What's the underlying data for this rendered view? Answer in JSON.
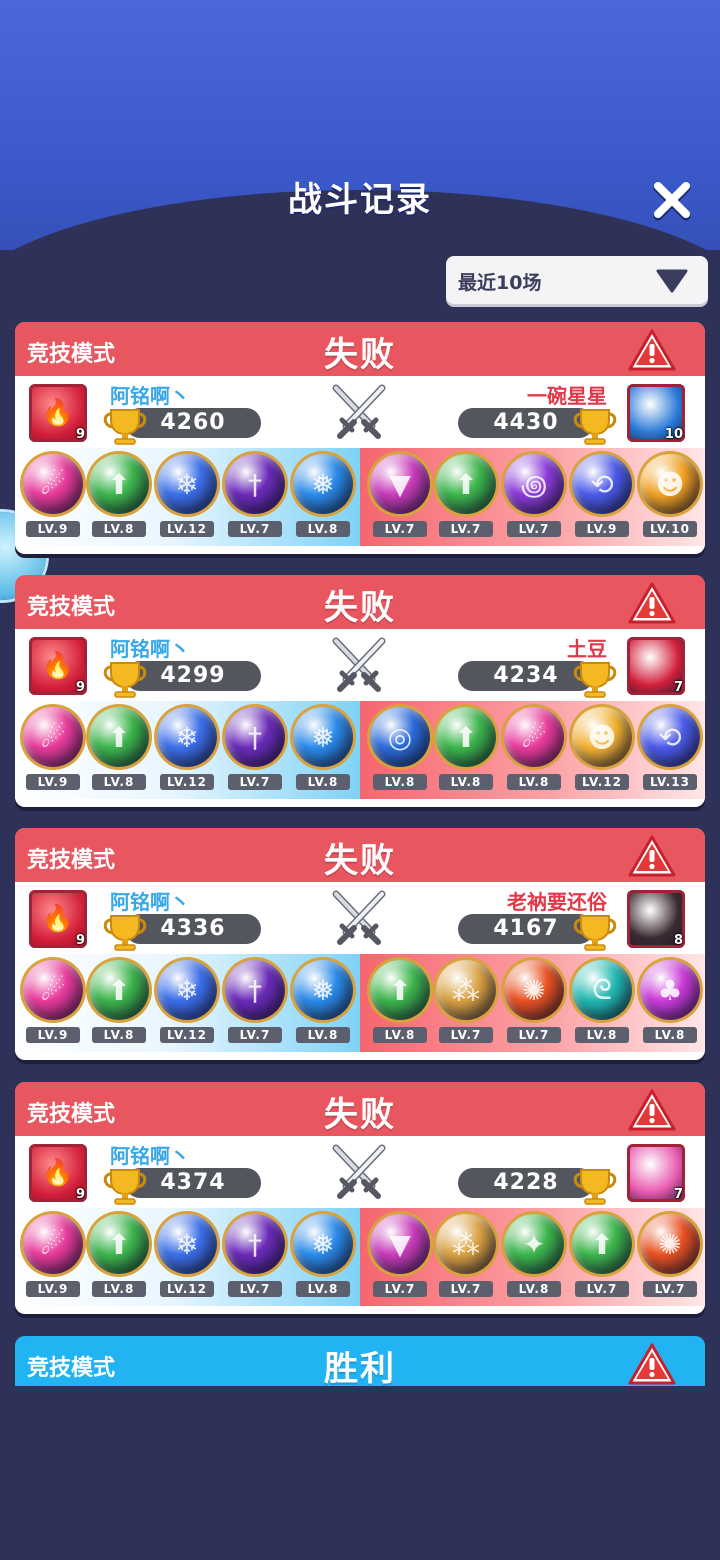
{
  "header": {
    "title": "战斗记录",
    "close_icon": "close-icon"
  },
  "filter": {
    "selected": "最近10场",
    "arrow_icon": "triangle-down-icon"
  },
  "colors": {
    "loss": "#e85660",
    "win": "#22b4f2",
    "bg": "#2e3158"
  },
  "battles": [
    {
      "mode": "竞技模式",
      "result": "失败",
      "me": {
        "name": "阿铭啊丶",
        "score": "4260",
        "avatar_level": "9",
        "avatar_color": "#d21f3a"
      },
      "opponent": {
        "name": "一碗星星",
        "score": "4430",
        "avatar_level": "10",
        "avatar_color": "#2a7ad8"
      },
      "my_skills": [
        {
          "icon": "meteor-icon",
          "level": "LV.9",
          "color": "#e83a9a"
        },
        {
          "icon": "arrow-up-icon",
          "level": "LV.8",
          "color": "#3bb44a"
        },
        {
          "icon": "snowflake-icon",
          "level": "LV.12",
          "color": "#3a6ee8"
        },
        {
          "icon": "sword-icon",
          "level": "LV.7",
          "color": "#6a2ab8"
        },
        {
          "icon": "ice-icon",
          "level": "LV.8",
          "color": "#2a8ae8"
        }
      ],
      "opp_skills": [
        {
          "icon": "prism-icon",
          "level": "LV.7",
          "color": "#c83ab8"
        },
        {
          "icon": "arrow-up-icon",
          "level": "LV.7",
          "color": "#3bb44a"
        },
        {
          "icon": "swirl-icon",
          "level": "LV.7",
          "color": "#8a3ad8"
        },
        {
          "icon": "return-icon",
          "level": "LV.9",
          "color": "#4a5ae8"
        },
        {
          "icon": "pumpkin-icon",
          "level": "LV.10",
          "color": "#f0a020"
        }
      ]
    },
    {
      "mode": "竞技模式",
      "result": "失败",
      "me": {
        "name": "阿铭啊丶",
        "score": "4299",
        "avatar_level": "9",
        "avatar_color": "#d21f3a"
      },
      "opponent": {
        "name": "土豆",
        "score": "4234",
        "avatar_level": "7",
        "avatar_color": "#d21f3a"
      },
      "my_skills": [
        {
          "icon": "meteor-icon",
          "level": "LV.9",
          "color": "#e83a9a"
        },
        {
          "icon": "arrow-up-icon",
          "level": "LV.8",
          "color": "#3bb44a"
        },
        {
          "icon": "snowflake-icon",
          "level": "LV.12",
          "color": "#3a6ee8"
        },
        {
          "icon": "sword-icon",
          "level": "LV.7",
          "color": "#6a2ab8"
        },
        {
          "icon": "ice-icon",
          "level": "LV.8",
          "color": "#2a8ae8"
        }
      ],
      "opp_skills": [
        {
          "icon": "vortex-icon",
          "level": "LV.8",
          "color": "#2a6ad8"
        },
        {
          "icon": "arrow-up-icon",
          "level": "LV.8",
          "color": "#3bb44a"
        },
        {
          "icon": "meteor-icon",
          "level": "LV.8",
          "color": "#e83a9a"
        },
        {
          "icon": "pumpkin-icon",
          "level": "LV.12",
          "color": "#f0b030"
        },
        {
          "icon": "return-icon",
          "level": "LV.13",
          "color": "#4a5ae8"
        }
      ]
    },
    {
      "mode": "竞技模式",
      "result": "失败",
      "me": {
        "name": "阿铭啊丶",
        "score": "4336",
        "avatar_level": "9",
        "avatar_color": "#d21f3a"
      },
      "opponent": {
        "name": "老衲要还俗",
        "score": "4167",
        "avatar_level": "8",
        "avatar_color": "#3a2a30"
      },
      "my_skills": [
        {
          "icon": "meteor-icon",
          "level": "LV.9",
          "color": "#e83a9a"
        },
        {
          "icon": "arrow-up-icon",
          "level": "LV.8",
          "color": "#3bb44a"
        },
        {
          "icon": "snowflake-icon",
          "level": "LV.12",
          "color": "#3a6ee8"
        },
        {
          "icon": "sword-icon",
          "level": "LV.7",
          "color": "#6a2ab8"
        },
        {
          "icon": "ice-icon",
          "level": "LV.8",
          "color": "#2a8ae8"
        }
      ],
      "opp_skills": [
        {
          "icon": "arrow-up-icon",
          "level": "LV.8",
          "color": "#3bb44a"
        },
        {
          "icon": "ghosts-icon",
          "level": "LV.7",
          "color": "#d8a040"
        },
        {
          "icon": "fire-claw-icon",
          "level": "LV.7",
          "color": "#e85020"
        },
        {
          "icon": "tornado-icon",
          "level": "LV.8",
          "color": "#20b8b0"
        },
        {
          "icon": "mushroom-icon",
          "level": "LV.8",
          "color": "#c83ad8"
        }
      ]
    },
    {
      "mode": "竞技模式",
      "result": "失败",
      "me": {
        "name": "阿铭啊丶",
        "score": "4374",
        "avatar_level": "9",
        "avatar_color": "#d21f3a"
      },
      "opponent": {
        "name": "",
        "score": "4228",
        "avatar_level": "7",
        "avatar_color": "#e85ab0"
      },
      "my_skills": [
        {
          "icon": "meteor-icon",
          "level": "LV.9",
          "color": "#e83a9a"
        },
        {
          "icon": "arrow-up-icon",
          "level": "LV.8",
          "color": "#3bb44a"
        },
        {
          "icon": "snowflake-icon",
          "level": "LV.12",
          "color": "#3a6ee8"
        },
        {
          "icon": "sword-icon",
          "level": "LV.7",
          "color": "#6a2ab8"
        },
        {
          "icon": "ice-icon",
          "level": "LV.8",
          "color": "#2a8ae8"
        }
      ],
      "opp_skills": [
        {
          "icon": "prism-icon",
          "level": "LV.7",
          "color": "#c83ab8"
        },
        {
          "icon": "ghosts-icon",
          "level": "LV.7",
          "color": "#d8a040"
        },
        {
          "icon": "star-ring-icon",
          "level": "LV.8",
          "color": "#3bb44a"
        },
        {
          "icon": "arrow-up-icon",
          "level": "LV.7",
          "color": "#3bb44a"
        },
        {
          "icon": "fire-claw-icon",
          "level": "LV.7",
          "color": "#e85020"
        }
      ]
    }
  ],
  "partial_battle": {
    "mode": "竞技模式",
    "result": "胜利"
  }
}
